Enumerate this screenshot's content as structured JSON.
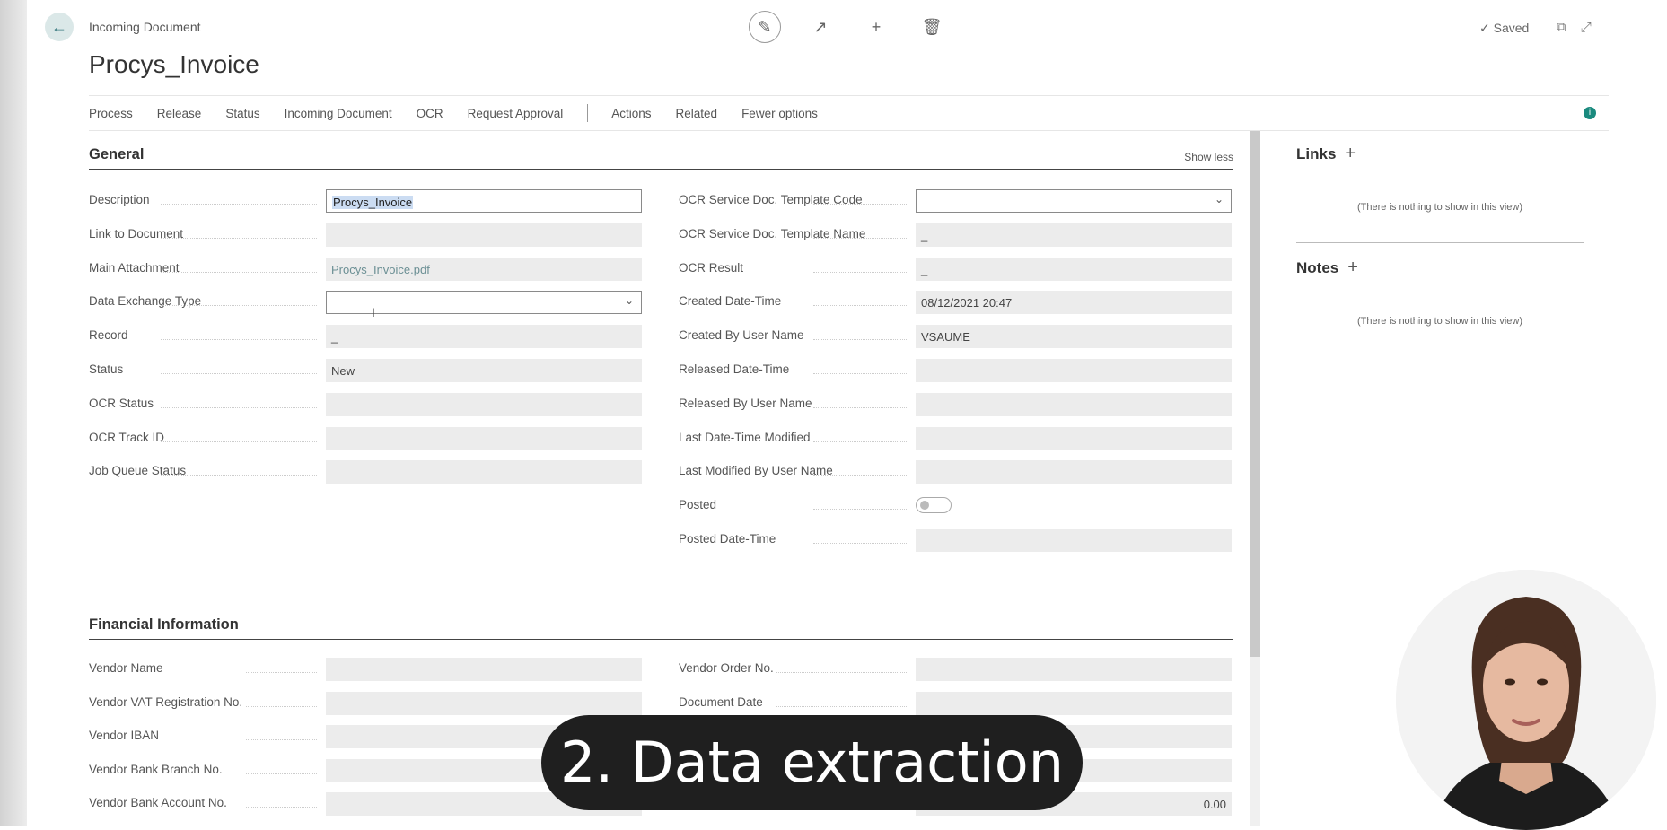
{
  "header": {
    "caption": "Incoming Document",
    "title": "Procys_Invoice",
    "saved": "Saved"
  },
  "icons": {
    "back": "arrow-left-icon",
    "edit": "pencil-icon",
    "share": "share-icon",
    "new": "plus-icon",
    "delete": "trash-icon",
    "saved": "check-icon",
    "open_new": "open-in-new-window-icon",
    "collapse": "collapse-icon",
    "info": "info-icon"
  },
  "actions": [
    {
      "label": "Process",
      "name": "action-process"
    },
    {
      "label": "Release",
      "name": "action-release"
    },
    {
      "label": "Status",
      "name": "action-status"
    },
    {
      "label": "Incoming Document",
      "name": "action-incoming-document"
    },
    {
      "label": "OCR",
      "name": "action-ocr"
    },
    {
      "label": "Request Approval",
      "name": "action-request-approval"
    },
    {
      "label": "Actions",
      "name": "action-actions"
    },
    {
      "label": "Related",
      "name": "action-related"
    },
    {
      "label": "Fewer options",
      "name": "action-fewer-options"
    }
  ],
  "general": {
    "title": "General",
    "show_less": "Show less",
    "left": [
      {
        "label": "Description",
        "value": "Procys_Invoice",
        "type": "text-selected"
      },
      {
        "label": "Link to Document",
        "value": "",
        "type": "readonly"
      },
      {
        "label": "Main Attachment",
        "value": "Procys_Invoice.pdf",
        "type": "link"
      },
      {
        "label": "Data Exchange Type",
        "value": "",
        "type": "dropdown"
      },
      {
        "label": "Record",
        "value": "_",
        "type": "readonly"
      },
      {
        "label": "Status",
        "value": "New",
        "type": "readonly"
      },
      {
        "label": "OCR Status",
        "value": "",
        "type": "readonly"
      },
      {
        "label": "OCR Track ID",
        "value": "",
        "type": "readonly"
      },
      {
        "label": "Job Queue Status",
        "value": "",
        "type": "readonly"
      }
    ],
    "right": [
      {
        "label": "OCR Service Doc. Template Code",
        "value": "",
        "type": "dropdown"
      },
      {
        "label": "OCR Service Doc. Template Name",
        "value": "_",
        "type": "readonly"
      },
      {
        "label": "OCR Result",
        "value": "_",
        "type": "readonly"
      },
      {
        "label": "Created Date-Time",
        "value": "08/12/2021 20:47",
        "type": "readonly"
      },
      {
        "label": "Created By User Name",
        "value": "VSAUME",
        "type": "readonly"
      },
      {
        "label": "Released Date-Time",
        "value": "",
        "type": "readonly"
      },
      {
        "label": "Released By User Name",
        "value": "",
        "type": "readonly"
      },
      {
        "label": "Last Date-Time Modified",
        "value": "",
        "type": "readonly"
      },
      {
        "label": "Last Modified By User Name",
        "value": "",
        "type": "readonly"
      },
      {
        "label": "Posted",
        "value": "",
        "type": "toggle"
      },
      {
        "label": "Posted Date-Time",
        "value": "",
        "type": "readonly"
      }
    ]
  },
  "financial": {
    "title": "Financial Information",
    "left": [
      {
        "label": "Vendor Name",
        "value": ""
      },
      {
        "label": "Vendor VAT Registration No.",
        "value": ""
      },
      {
        "label": "Vendor IBAN",
        "value": ""
      },
      {
        "label": "Vendor Bank Branch No.",
        "value": ""
      },
      {
        "label": "Vendor Bank Account No.",
        "value": ""
      }
    ],
    "right": [
      {
        "label": "Vendor Order No.",
        "value": ""
      },
      {
        "label": "Document Date",
        "value": ""
      },
      {
        "label": "",
        "value": ""
      },
      {
        "label": "",
        "value": ""
      },
      {
        "label": "",
        "value": "0.00"
      }
    ]
  },
  "factbox": {
    "links_title": "Links",
    "links_empty": "(There is nothing to show in this view)",
    "notes_title": "Notes",
    "notes_empty": "(There is nothing to show in this view)"
  },
  "overlay": {
    "caption": "2. Data extraction"
  }
}
